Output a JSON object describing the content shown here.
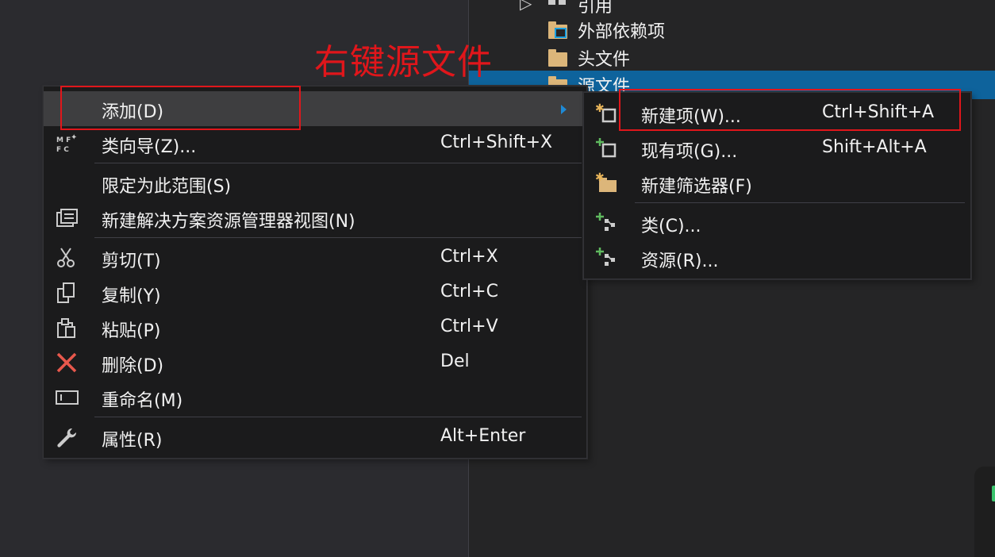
{
  "solution_tree": {
    "items": [
      {
        "label": "引用"
      },
      {
        "label": "外部依赖项"
      },
      {
        "label": "头文件"
      },
      {
        "label": "源文件"
      }
    ]
  },
  "annotation": {
    "text": "右键源文件",
    "color": "#e0161b"
  },
  "context_menu": {
    "items": [
      {
        "label": "添加(D)",
        "shortcut": ""
      },
      {
        "label": "类向导(Z)...",
        "shortcut": "Ctrl+Shift+X"
      },
      {
        "label": "限定为此范围(S)",
        "shortcut": ""
      },
      {
        "label": "新建解决方案资源管理器视图(N)",
        "shortcut": ""
      },
      {
        "label": "剪切(T)",
        "shortcut": "Ctrl+X"
      },
      {
        "label": "复制(Y)",
        "shortcut": "Ctrl+C"
      },
      {
        "label": "粘贴(P)",
        "shortcut": "Ctrl+V"
      },
      {
        "label": "删除(D)",
        "shortcut": "Del"
      },
      {
        "label": "重命名(M)",
        "shortcut": ""
      },
      {
        "label": "属性(R)",
        "shortcut": "Alt+Enter"
      }
    ]
  },
  "submenu": {
    "items": [
      {
        "label": "新建项(W)...",
        "shortcut": "Ctrl+Shift+A"
      },
      {
        "label": "现有项(G)...",
        "shortcut": "Shift+Alt+A"
      },
      {
        "label": "新建筛选器(F)",
        "shortcut": ""
      },
      {
        "label": "类(C)...",
        "shortcut": ""
      },
      {
        "label": "资源(R)...",
        "shortcut": ""
      }
    ]
  },
  "colors": {
    "selection": "#0e639c",
    "menu_bg": "#1b1b1c",
    "hover": "#3e3e40",
    "highlight_box": "#e0161b",
    "accent_arrow": "#1e8ad6"
  }
}
